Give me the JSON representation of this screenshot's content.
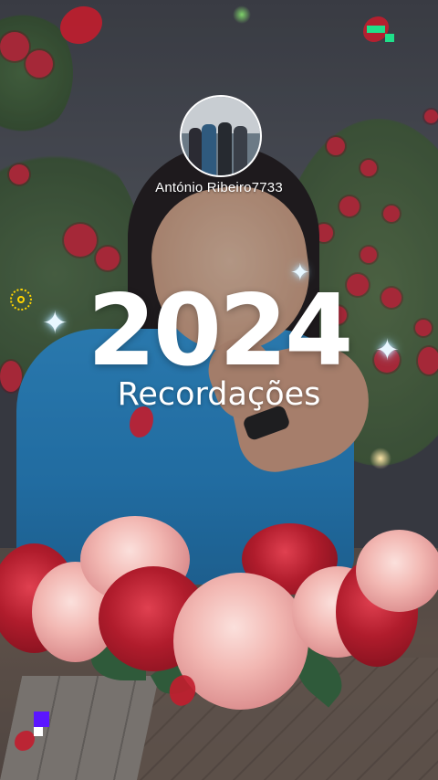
{
  "profile": {
    "username": "António Ribeiro7733",
    "avatar_alt": "profile-photo"
  },
  "title": {
    "year": "2024",
    "subtitle": "Recordações"
  },
  "decorations": {
    "sparkle_glyph": "✦",
    "accent_green": "#1fe08a",
    "accent_purple": "#5b16ff",
    "sun_color": "#ffd400",
    "rose_red": "#c8283a",
    "rose_pink": "#f2b7b2"
  },
  "icons": [
    "sparkle-icon",
    "sun-icon",
    "pixel-chip-icon"
  ]
}
